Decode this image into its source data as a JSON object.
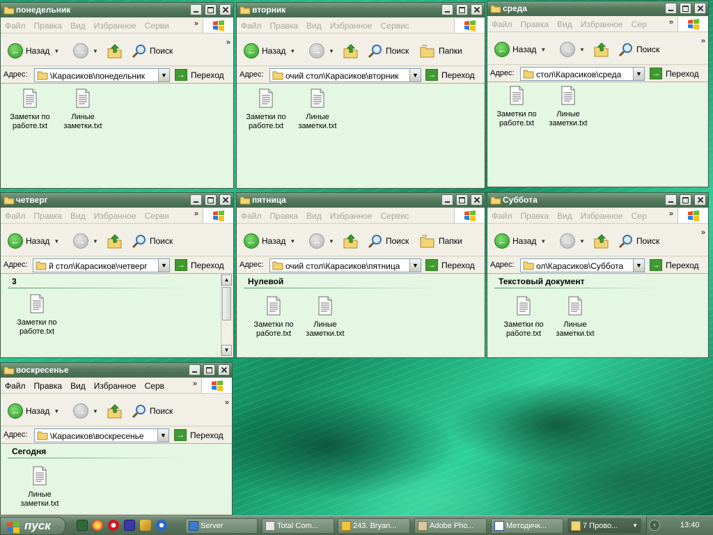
{
  "menu": {
    "file": "Файл",
    "edit": "Правка",
    "view": "Вид",
    "favorites": "Избранное",
    "service": "Сервис",
    "service_trunc": "Серви",
    "service_trunc2": "Серв",
    "service_trunc3": "Сер"
  },
  "toolbar": {
    "back": "Назад",
    "search": "Поиск",
    "folders": "Папки"
  },
  "address": {
    "label": "Адрес:",
    "go": "Переход"
  },
  "windows": {
    "mon": {
      "title": "понедельник",
      "path": "\\Карасиков\\понедельник",
      "files": [
        "Заметки по работе.txt",
        "Линые заметки.txt"
      ]
    },
    "tue": {
      "title": "вторник",
      "path": "очий стол\\Карасиков\\вторник",
      "files": [
        "Заметки по работе.txt",
        "Линые заметки.txt"
      ]
    },
    "wed": {
      "title": "среда",
      "path": "стол\\Карасиков\\среда",
      "files": [
        "Заметки по работе.txt",
        "Линые заметки.txt"
      ]
    },
    "thu": {
      "title": "четверг",
      "path": "й стол\\Карасиков\\четверг",
      "group": "3",
      "files": [
        "Заметки по работе.txt"
      ]
    },
    "fri": {
      "title": "пятница",
      "path": "очий стол\\Карасиков\\пятница",
      "group": "Нулевой",
      "files": [
        "Заметки по работе.txt",
        "Линые заметки.txt"
      ]
    },
    "sat": {
      "title": "Суббота",
      "path": "ол\\Карасиков\\Суббота",
      "group": "Текстовый документ",
      "files": [
        "Заметки по работе.txt",
        "Линые заметки.txt"
      ]
    },
    "sun": {
      "title": "воскресенье",
      "path": "\\Карасиков\\воскресенье",
      "group": "Сегодня",
      "files": [
        "Линые заметки.txt"
      ]
    }
  },
  "taskbar": {
    "start": "пуск",
    "tasks": [
      "Server",
      "Total Com...",
      "243. Bryan...",
      "Adobe Pho...",
      "Методичк...",
      "7 Прово..."
    ],
    "lang": "EN",
    "clock": "13:40"
  },
  "colors": {
    "titlebar": "#56795f",
    "content_bg": "#e4f7e2",
    "taskbar": "#5c7660"
  }
}
